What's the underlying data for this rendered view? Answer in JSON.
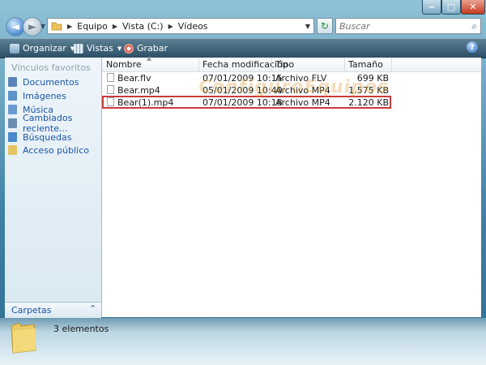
{
  "window": {
    "controls": {
      "minimize": "−",
      "maximize": "□",
      "close": "✕"
    }
  },
  "nav": {
    "back_glyph": "◄",
    "forward_glyph": "►",
    "breadcrumb": [
      "Equipo",
      "Vista (C:)",
      "Vídeos"
    ],
    "search_placeholder": "Buscar"
  },
  "toolbar": {
    "organize": "Organizar",
    "views": "Vistas",
    "burn": "Grabar",
    "help": "?"
  },
  "sidebar": {
    "title": "Vínculos favoritos",
    "items": [
      {
        "label": "Documentos",
        "icon": "documents-icon",
        "color": "#5a84b9"
      },
      {
        "label": "Imágenes",
        "icon": "pictures-icon",
        "color": "#5a94c9"
      },
      {
        "label": "Música",
        "icon": "music-icon",
        "color": "#6a9ad0"
      },
      {
        "label": "Cambiados reciente...",
        "icon": "recent-icon",
        "color": "#6d8eb3"
      },
      {
        "label": "Búsquedas",
        "icon": "searches-icon",
        "color": "#4a8acb"
      },
      {
        "label": "Acceso público",
        "icon": "public-folder-icon",
        "color": "#e4c462"
      }
    ],
    "folders_label": "Carpetas",
    "folders_chevron": "⌃"
  },
  "table": {
    "columns": [
      "Nombre",
      "Fecha modificación",
      "Tipo",
      "Tamaño"
    ],
    "rows": [
      {
        "name": "Bear.flv",
        "date": "07/01/2009 10:15",
        "type": "Archivo FLV",
        "size": "699 KB"
      },
      {
        "name": "Bear.mp4",
        "date": "05/01/2009 10:40",
        "type": "Archivo MP4",
        "size": "1.575 KB"
      },
      {
        "name": "Bear(1).mp4",
        "date": "07/01/2009 10:18",
        "type": "Archivo MP4",
        "size": "2.120 KB"
      }
    ],
    "highlighted_row": 2
  },
  "watermark": "ConfiguroEquipos",
  "status": {
    "count": "3 elementos"
  },
  "colors": {
    "accent": "#1a55a6",
    "highlight_border": "#c93b3b",
    "toolbar_bg": "#2b4f66"
  }
}
